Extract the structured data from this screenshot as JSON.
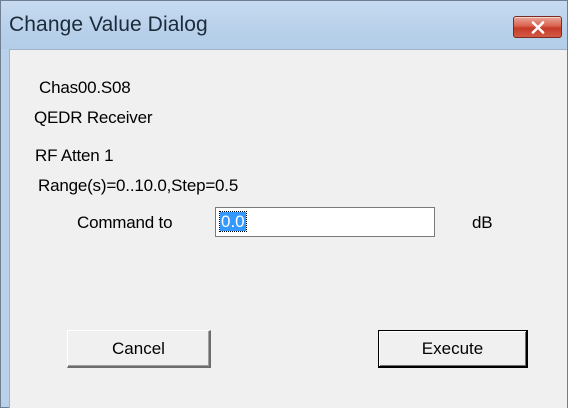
{
  "window": {
    "title": "Change Value Dialog"
  },
  "info": {
    "chassis_slot": "Chas00.S08",
    "device": "QEDR Receiver",
    "parameter": "RF Atten 1",
    "range": "Range(s)=0..10.0,Step=0.5"
  },
  "command": {
    "label": "Command to",
    "value": "0.0",
    "unit": "dB"
  },
  "buttons": {
    "cancel": "Cancel",
    "execute": "Execute"
  },
  "icons": {
    "close": "close-icon"
  },
  "colors": {
    "titlebar": "#b9d1ea",
    "close_button": "#c53b28",
    "selection": "#3399ff",
    "client_bg": "#f0f0f0"
  }
}
